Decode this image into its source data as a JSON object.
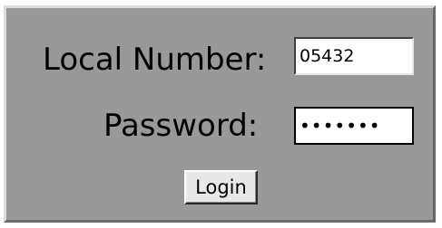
{
  "login_form": {
    "local_number_label": "Local Number:",
    "local_number_value": "05432",
    "password_label": "Password:",
    "password_value": "•••••••",
    "login_button_label": "Login"
  }
}
